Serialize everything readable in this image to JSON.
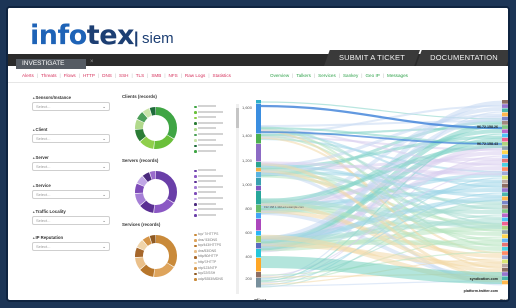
{
  "header": {
    "logo_main_a": "info",
    "logo_main_b": "tex",
    "logo_sep": "|",
    "logo_sub": "siem",
    "submit_ticket": "SUBMIT A TICKET",
    "documentation": "DOCUMENTATION"
  },
  "tab": {
    "label": "INVESTIGATE",
    "close_icon": "x-icon"
  },
  "nav_left": [
    "Alerts",
    "Threats",
    "Flows",
    "HTTP",
    "DNS",
    "SSH",
    "TLS",
    "SMB",
    "NFS",
    "Raw Logs",
    "Statistics"
  ],
  "nav_left_separator": "|",
  "nav_right": [
    "Overview",
    "Talkers",
    "Services",
    "Sankey",
    "Geo IP",
    "Messages"
  ],
  "filters": [
    {
      "label": "Sensors/Instance",
      "placeholder": "Select..."
    },
    {
      "label": "Client",
      "placeholder": "Select..."
    },
    {
      "label": "Server",
      "placeholder": "Select..."
    },
    {
      "label": "Service",
      "placeholder": "Select..."
    },
    {
      "label": "Traffic Locality",
      "placeholder": "Select..."
    },
    {
      "label": "IP Reputation",
      "placeholder": "Select..."
    }
  ],
  "donuts": [
    {
      "title": "Clients (records)",
      "colors": [
        "#3fa544",
        "#6abf3a",
        "#8fcf4b",
        "#2b7c35",
        "#b1d98c",
        "#4c9f58",
        "#c9e4a8",
        "#1f6b3a"
      ]
    },
    {
      "title": "Servers (records)",
      "colors": [
        "#6a3fa8",
        "#8b58c4",
        "#5a2f93",
        "#a57fd6",
        "#7d4bb8",
        "#c0a7e5",
        "#4b2a7d",
        "#9a6bcc"
      ]
    },
    {
      "title": "Services (records)",
      "colors": [
        "#c98a3a",
        "#dea45c",
        "#b7762b",
        "#eac08a",
        "#a6672b",
        "#f0d4aa",
        "#d49447",
        "#8f5a22"
      ]
    }
  ],
  "donut_legends": [
    [
      "",
      "",
      "",
      "",
      "",
      "",
      "",
      "",
      ""
    ],
    [
      "",
      "",
      "",
      "",
      "",
      "",
      "",
      "",
      ""
    ],
    [
      "tcp/ 7/HTTPS",
      "dns/ 53/DNS",
      "tcp/443/HTTPS",
      "dns/53/DNS",
      "http/80/HTTP",
      "http/7/HTTP",
      "ntp/123/NTP",
      "tcp/22/SSH",
      "udp/5353/MDNS"
    ]
  ],
  "sankey": {
    "y_ticks": [
      "1,600",
      "1,400",
      "1,200",
      "1,000",
      "800",
      "600",
      "400",
      "200"
    ],
    "x_left_label": "Client",
    "x_right_label": "Server",
    "node_labels_right": [
      "96.72.158.26",
      "96.72.158.43",
      "syndication.com",
      "platform.twitter.com"
    ],
    "node_label_left": "192.168.1.102.ext.example.com"
  },
  "colors": {
    "frame": "#0f2440",
    "logo_blue": "#1e63b7",
    "nav_red": "#d6315c",
    "nav_green": "#2fa24a"
  }
}
